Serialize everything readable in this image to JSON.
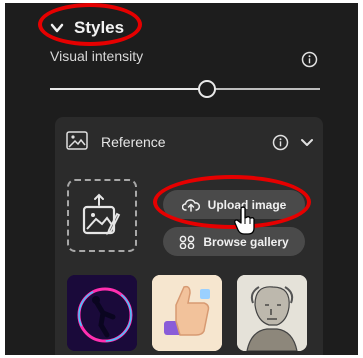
{
  "styles": {
    "title": "Styles",
    "visual_intensity_label": "Visual intensity",
    "slider_value": 0.58
  },
  "reference": {
    "title": "Reference",
    "upload_label": "Upload image",
    "browse_label": "Browse gallery",
    "thumbnails": [
      "neon-ring-figure-icon",
      "thumbs-up-icon",
      "portrait-sketch-icon"
    ]
  },
  "colors": {
    "panel_bg": "#1d1d1d",
    "card_bg": "#2b2b2b",
    "button_bg": "#4a4a4a",
    "annotation": "#e60000"
  }
}
